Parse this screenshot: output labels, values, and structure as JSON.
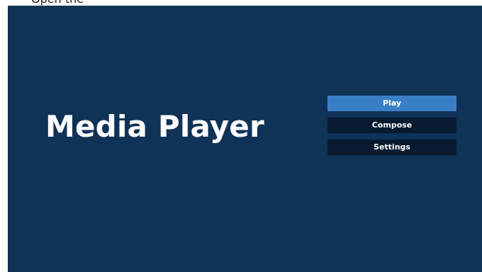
{
  "top_caption": "Open the",
  "app": {
    "title": "Media Player"
  },
  "menu": {
    "items": [
      {
        "label": "Play",
        "selected": true
      },
      {
        "label": "Compose",
        "selected": false
      },
      {
        "label": "Settings",
        "selected": false
      }
    ]
  },
  "colors": {
    "background": "#0f3257",
    "selected_item": "#3a7fc6",
    "item": "#071a30",
    "text": "#ffffff"
  }
}
